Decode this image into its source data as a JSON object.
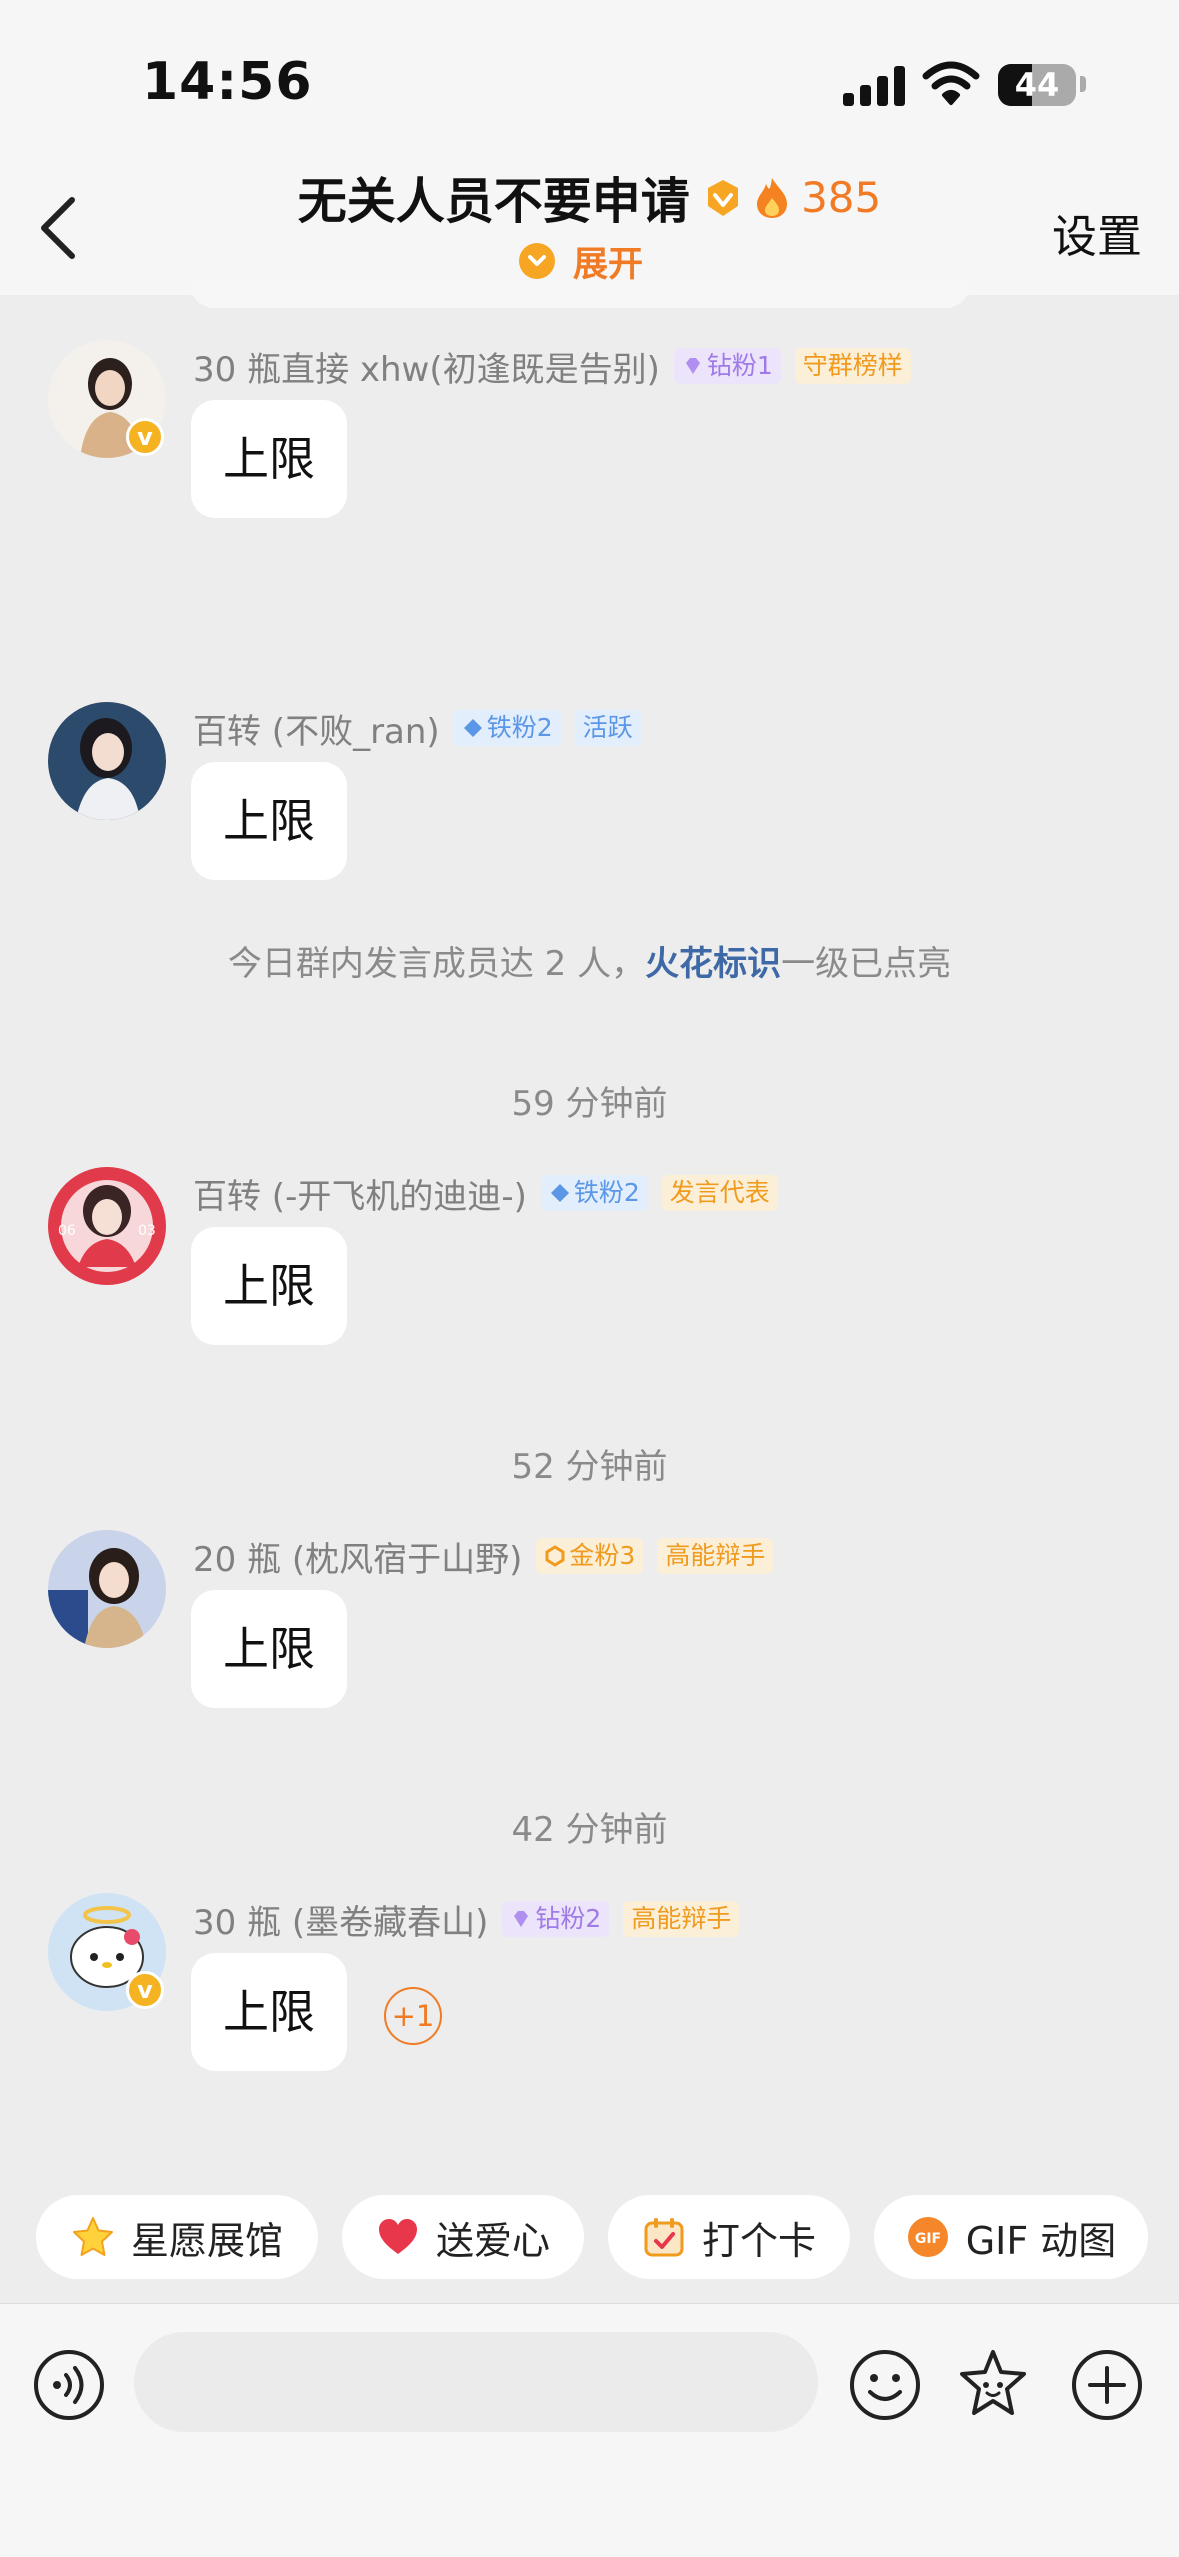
{
  "status_bar": {
    "time": "14:56",
    "battery": "44",
    "battery_level_percent": 44
  },
  "header": {
    "title": "无关人员不要申请",
    "heat": "385",
    "expand_label": "展开",
    "settings_label": "设置"
  },
  "messages": [
    {
      "name": "30 瓶直接 xhw(初逢既是告别)",
      "fan_tag": "钻粉1",
      "role_tag": "守群榜样",
      "text": "上限"
    },
    {
      "name": "百转 (不败_ran)",
      "fan_tag": "铁粉2",
      "role_tag": "活跃",
      "text": "上限"
    },
    {
      "name": "百转 (-开飞机的迪迪-)",
      "fan_tag": "铁粉2",
      "role_tag": "发言代表",
      "text": "上限"
    },
    {
      "name": "20 瓶 (枕风宿于山野)",
      "fan_tag": "金粉3",
      "role_tag": "高能辩手",
      "text": "上限"
    },
    {
      "name": "30 瓶 (墨卷藏春山)",
      "fan_tag": "钻粉2",
      "role_tag": "高能辩手",
      "text": "上限",
      "reaction": "+1"
    }
  ],
  "system_notice": {
    "prefix": "今日群内发言成员达 2 人，",
    "highlight": "火花标识",
    "suffix": "一级已点亮"
  },
  "timestamps": [
    "59 分钟前",
    "52 分钟前",
    "42 分钟前"
  ],
  "quick_actions": [
    "星愿展馆",
    "送爱心",
    "打个卡",
    "GIF 动图"
  ],
  "input": {
    "placeholder": ""
  },
  "colors": {
    "accent": "#f07b24",
    "badge_yellow": "#f6b321",
    "link_blue": "#3e69a6"
  }
}
